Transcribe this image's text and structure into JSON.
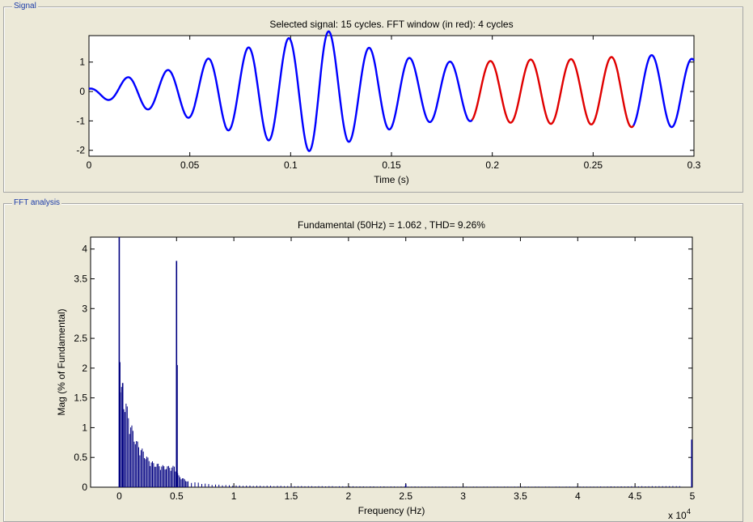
{
  "panels": {
    "signal": "Signal",
    "fft": "FFT analysis"
  },
  "chart_data": [
    {
      "type": "line",
      "title": "Selected signal: 15 cycles. FFT window (in red): 4 cycles",
      "xlabel": "Time (s)",
      "ylabel": "",
      "xlim": [
        0,
        0.3
      ],
      "ylim": [
        -2.2,
        1.9
      ],
      "xticks": [
        "0",
        "0.05",
        "0.1",
        "0.15",
        "0.2",
        "0.25",
        "0.3"
      ],
      "yticks": [
        "-2",
        "-1",
        "0",
        "1"
      ],
      "fundamental_hz": 50,
      "highlight_window_s": [
        0.19,
        0.27
      ],
      "series": [
        {
          "color": "#0000ff",
          "envelope_t": [
            0,
            0.02,
            0.045,
            0.065,
            0.085,
            0.105,
            0.115,
            0.125,
            0.145,
            0.165,
            0.185,
            0.205,
            0.225,
            0.245,
            0.265,
            0.285,
            0.3
          ],
          "envelope_amp": [
            0.1,
            0.5,
            0.8,
            1.25,
            1.6,
            1.9,
            2.2,
            1.8,
            1.35,
            1.05,
            1.0,
            1.05,
            1.1,
            1.1,
            1.2,
            1.25,
            1.1
          ]
        },
        {
          "color": "#e00000",
          "window": [
            0.19,
            0.27
          ]
        }
      ]
    },
    {
      "type": "bar",
      "title": "Fundamental (50Hz) = 1.062 , THD= 9.26%",
      "xlabel": "Frequency (Hz)",
      "ylabel": "Mag (% of Fundamental)",
      "xlim": [
        -2500,
        50000
      ],
      "ylim": [
        0,
        4.2
      ],
      "x_exponent_label": "x 10",
      "x_exponent_power": "4",
      "xticks": [
        "0",
        "0.5",
        "1",
        "1.5",
        "2",
        "2.5",
        "3",
        "3.5",
        "4",
        "4.5",
        "5"
      ],
      "yticks": [
        "0",
        "0.5",
        "1",
        "1.5",
        "2",
        "2.5",
        "3",
        "3.5",
        "4"
      ],
      "color": "#000080",
      "peaks": [
        {
          "freq_hz": 0,
          "mag": 4.2
        },
        {
          "freq_hz": 50,
          "mag": 2.1
        },
        {
          "freq_hz": 300,
          "mag": 1.75
        },
        {
          "freq_hz": 5000,
          "mag": 3.8
        },
        {
          "freq_hz": 5050,
          "mag": 2.05
        },
        {
          "freq_hz": 25000,
          "mag": 0.05
        },
        {
          "freq_hz": 49950,
          "mag": 0.8
        }
      ],
      "envelope_freq_hz": [
        100,
        600,
        1000,
        1500,
        2000,
        2500,
        3000,
        4000,
        4800,
        5200,
        6000,
        8000,
        10000,
        15000,
        20000,
        30000,
        40000,
        49000
      ],
      "envelope_mag": [
        1.75,
        1.45,
        1.1,
        0.8,
        0.65,
        0.5,
        0.42,
        0.36,
        0.36,
        0.2,
        0.1,
        0.05,
        0.03,
        0.02,
        0.015,
        0.01,
        0.01,
        0.02
      ]
    }
  ]
}
